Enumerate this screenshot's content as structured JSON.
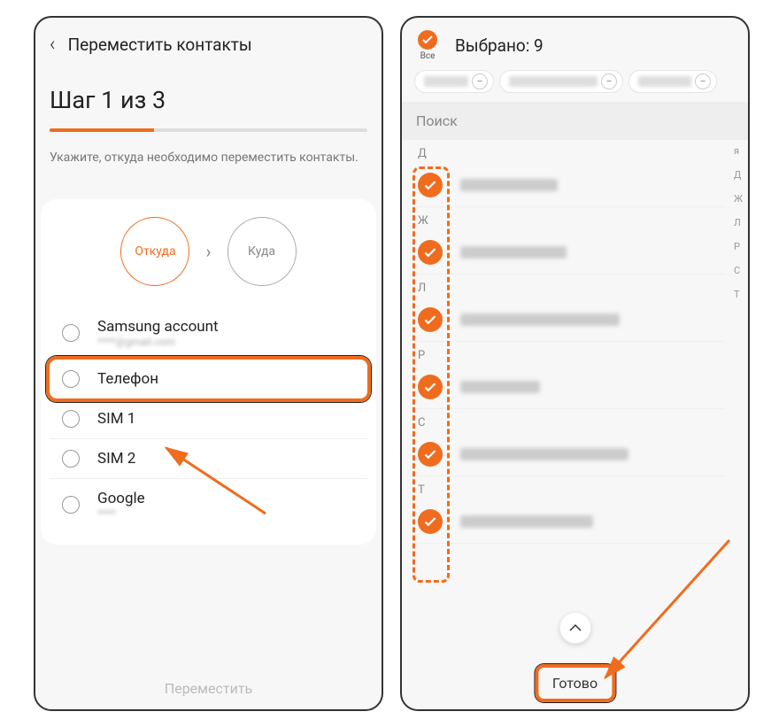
{
  "left": {
    "title": "Переместить контакты",
    "step_title": "Шаг 1 из 3",
    "hint": "Укажите, откуда необходимо переместить контакты.",
    "from_label": "Откуда",
    "to_label": "Куда",
    "sources": [
      {
        "name": "Samsung account",
        "sub": "****@gmail.com"
      },
      {
        "name": "Телефон",
        "sub": "",
        "highlighted": true
      },
      {
        "name": "SIM 1",
        "sub": ""
      },
      {
        "name": "SIM 2",
        "sub": ""
      },
      {
        "name": "Google",
        "sub": "****"
      }
    ],
    "footer": "Переместить"
  },
  "right": {
    "all_label": "Все",
    "selected_label": "Выбрано: 9",
    "search": "Поиск",
    "groups": [
      {
        "letter": "Д",
        "count": 1
      },
      {
        "letter": "Ж",
        "count": 1
      },
      {
        "letter": "Л",
        "count": 1
      },
      {
        "letter": "Р",
        "count": 1
      },
      {
        "letter": "С",
        "count": 1
      },
      {
        "letter": "Т",
        "count": 1
      }
    ],
    "index": [
      "я",
      "Д",
      "Ж",
      "Л",
      "Р",
      "С",
      "Т"
    ],
    "done": "Готово"
  },
  "colors": {
    "accent": "#ef6c1f"
  }
}
